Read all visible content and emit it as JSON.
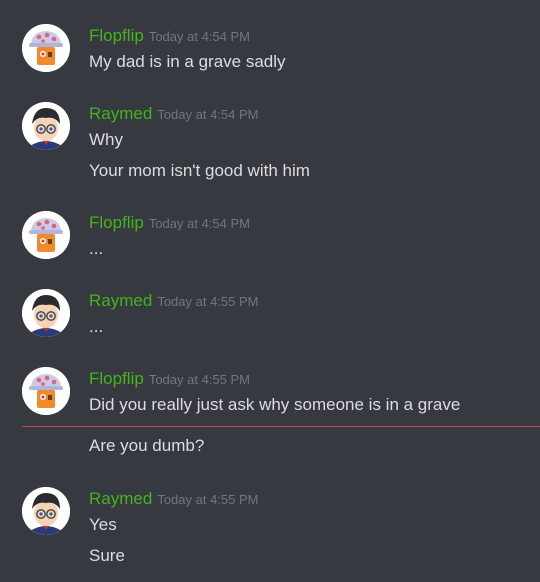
{
  "colors": {
    "background": "#36393f",
    "username": "#43b41b",
    "timestamp": "#72767d",
    "message_text": "#dcddde",
    "new_messages_divider": "#c84b4b"
  },
  "messages": [
    {
      "username": "Flopflip",
      "avatar_icon": "flopflip-avatar-icon",
      "timestamp": "Today at 4:54 PM",
      "lines": [
        "My dad is in a grave sadly"
      ]
    },
    {
      "username": "Raymed",
      "avatar_icon": "raymed-avatar-icon",
      "timestamp": "Today at 4:54 PM",
      "lines": [
        "Why",
        "Your mom isn't good with him"
      ]
    },
    {
      "username": "Flopflip",
      "avatar_icon": "flopflip-avatar-icon",
      "timestamp": "Today at 4:54 PM",
      "lines": [
        "..."
      ]
    },
    {
      "username": "Raymed",
      "avatar_icon": "raymed-avatar-icon",
      "timestamp": "Today at 4:55 PM",
      "lines": [
        "..."
      ]
    },
    {
      "username": "Flopflip",
      "avatar_icon": "flopflip-avatar-icon",
      "timestamp": "Today at 4:55 PM",
      "lines": [
        "Did you really just ask why someone is in a grave",
        "Are you dumb?"
      ]
    },
    {
      "username": "Raymed",
      "avatar_icon": "raymed-avatar-icon",
      "timestamp": "Today at 4:55 PM",
      "lines": [
        "Yes",
        "Sure"
      ]
    }
  ]
}
